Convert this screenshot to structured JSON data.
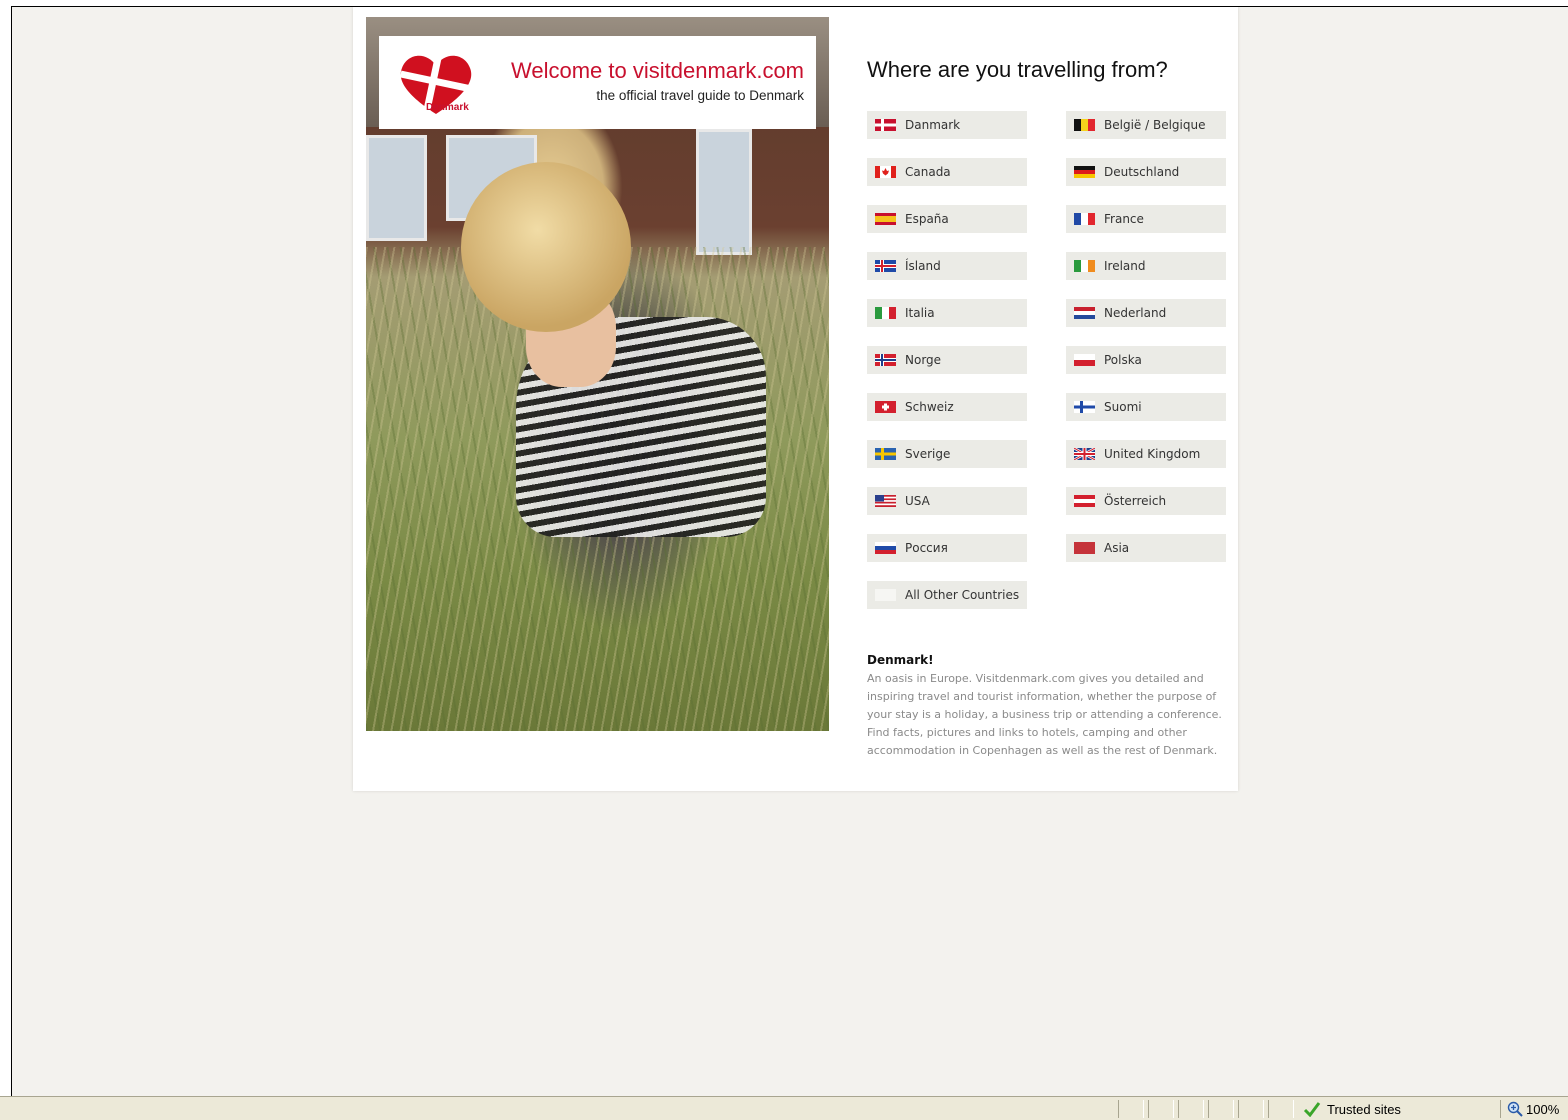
{
  "banner": {
    "title": "Welcome to visitdenmark.com",
    "subtitle": "the official travel guide to Denmark",
    "logo_text": "Denmark"
  },
  "heading": "Where are you travelling from?",
  "countries": [
    {
      "label": "Danmark",
      "flag": "flag-dk"
    },
    {
      "label": "België / Belgique",
      "flag": "flag-be"
    },
    {
      "label": "Canada",
      "flag": "flag-ca"
    },
    {
      "label": "Deutschland",
      "flag": "flag-de"
    },
    {
      "label": "España",
      "flag": "flag-es"
    },
    {
      "label": "France",
      "flag": "flag-fr"
    },
    {
      "label": "Ísland",
      "flag": "flag-is"
    },
    {
      "label": "Ireland",
      "flag": "flag-ie"
    },
    {
      "label": "Italia",
      "flag": "flag-it"
    },
    {
      "label": "Nederland",
      "flag": "flag-nl"
    },
    {
      "label": "Norge",
      "flag": "flag-no"
    },
    {
      "label": "Polska",
      "flag": "flag-pl"
    },
    {
      "label": "Schweiz",
      "flag": "flag-ch"
    },
    {
      "label": "Suomi",
      "flag": "flag-fi"
    },
    {
      "label": "Sverige",
      "flag": "flag-se"
    },
    {
      "label": "United Kingdom",
      "flag": "flag-gb"
    },
    {
      "label": "USA",
      "flag": "flag-us"
    },
    {
      "label": "Österreich",
      "flag": "flag-at"
    },
    {
      "label": "Россия",
      "flag": "flag-ru"
    },
    {
      "label": "Asia",
      "flag": "flag-asia"
    },
    {
      "label": "All Other Countries",
      "flag": "flag-other"
    }
  ],
  "about": {
    "title": "Denmark!",
    "text": "An oasis in Europe. Visitdenmark.com gives you detailed and inspiring travel and tourist information, whether the purpose of your stay is a holiday, a business trip or attending a conference. Find facts, pictures and links to hotels, camping and other accommodation in Copenhagen as well as the rest of Denmark."
  },
  "statusbar": {
    "zone": "Trusted sites",
    "zoom": "100%"
  },
  "colors": {
    "brand_red": "#c8102e",
    "page_bg": "#f3f2ee",
    "button_bg": "#ebebe6"
  }
}
